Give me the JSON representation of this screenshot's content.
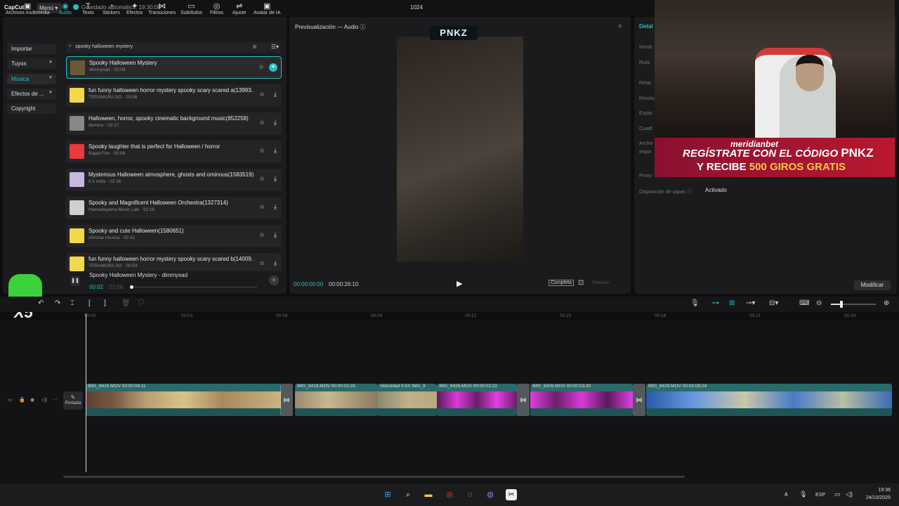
{
  "app": {
    "logo": "CapCut",
    "menu": "Menú",
    "autosave": "Guardado automático: 19:30:08",
    "project_title": "1024"
  },
  "toolbar": [
    {
      "label": "Archivos multimedia",
      "icon": "media-icon"
    },
    {
      "label": "Audio",
      "icon": "audio-icon"
    },
    {
      "label": "Texto",
      "icon": "text-icon"
    },
    {
      "label": "Stickers",
      "icon": "sticker-icon"
    },
    {
      "label": "Efectos",
      "icon": "effects-icon"
    },
    {
      "label": "Transiciones",
      "icon": "transitions-icon"
    },
    {
      "label": "Subtítulos",
      "icon": "subtitles-icon"
    },
    {
      "label": "Filtros",
      "icon": "filters-icon"
    },
    {
      "label": "Ajuste",
      "icon": "adjust-icon"
    },
    {
      "label": "Avatar de IA",
      "icon": "avatar-icon"
    }
  ],
  "sidebar": [
    "Importar",
    "Tuyos",
    "Música",
    "Efectos de ...",
    "Copyright"
  ],
  "search": {
    "value": "spooky halloween mystery"
  },
  "tracks": [
    {
      "title": "Spooky Halloween Mystery",
      "sub": "dimmysad · 02:06",
      "color": "#6a5a3a"
    },
    {
      "title": "fun funny halloween horror mystery spooky scary scared a(13993...",
      "sub": "TERAMURA SO · 03:06",
      "color": "#f2d84a"
    },
    {
      "title": "Halloween, horror, spooky cinematic background music(852258)",
      "sub": "domino · 02:17",
      "color": "#888888"
    },
    {
      "title": "Spooky laughter that is perfect for Halloween / horror",
      "sub": "Rapid Fire · 00:06",
      "color": "#e83a3a"
    },
    {
      "title": "Mysterious Halloween atmosphere, ghosts and ominous(1583519)",
      "sub": "K's notix · 02:16",
      "color": "#c8b8e0"
    },
    {
      "title": "Spooky and Magnificent Halloween Orchestra(1327314)",
      "sub": "Hamadayama Music Lab · 02:18",
      "color": "#d0d0d0"
    },
    {
      "title": "Spooky and cute Halloween(1580651)",
      "sub": "chroma musica · 02:41",
      "color": "#f2d84a"
    },
    {
      "title": "fun funny halloween horror mystery spooky scary scared b(14009...",
      "sub": "TERAMURA SO · 00:54",
      "color": "#f2d84a"
    }
  ],
  "player": {
    "title": "Spooky Halloween Mystery - dimmysad",
    "current": "00:02",
    "total": "02:06"
  },
  "preview": {
    "title": "Previsualización — Audio",
    "current": "00:00:00:00",
    "total": "00:00:26:10",
    "ratio_btn": "Completa",
    "ratio_lbl": "Relación",
    "overlay_logo": "PNKZ"
  },
  "details": {
    "title": "Detal",
    "labels": [
      "Nomb",
      "Ruta:",
      "Relac",
      "Resolu",
      "Espac",
      "Cuadr",
      "Archiv",
      "Impor",
      "Proxy",
      "Disposición de capas"
    ],
    "layers_value": "Activado",
    "modify": "Modificar"
  },
  "ad": {
    "brand": "meridianbet",
    "line1": "REGÍSTRATE CON EL CÓDIGO",
    "code": "PNKZ",
    "line2a": "Y RECIBE",
    "line2b": "500 GIROS GRATIS"
  },
  "mascot": {
    "text": "X5"
  },
  "ruler": [
    "00:00",
    "00:03",
    "00:06",
    "00:09",
    "00:12",
    "00:15",
    "00:18",
    "00:21",
    "00:24"
  ],
  "timeline": {
    "cover": "Portada",
    "clips": [
      {
        "label": "IMG_8415.MOV   00:00:06:11"
      },
      {
        "label": "IMG_8418.MOV   00:00:02:25"
      },
      {
        "label": "Velocidad 0.5X   IMG_8"
      },
      {
        "label": "IMG_8426.MOV   00:00:02:22"
      },
      {
        "label": "IMG_8426.MOV   00:00:03:20"
      },
      {
        "label": "IMG_8429.MOV   00:00:08:24"
      }
    ]
  },
  "taskbar": {
    "lang": "ESP",
    "time": "19:36",
    "date": "24/10/2025"
  }
}
